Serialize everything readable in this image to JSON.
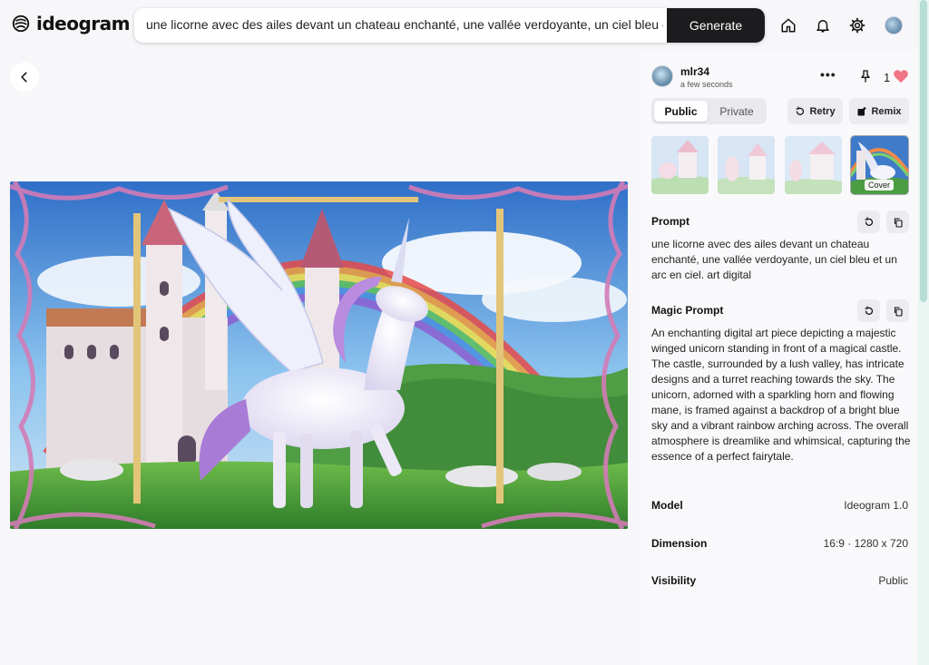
{
  "brand": {
    "name": "ideogram"
  },
  "search": {
    "value": "une licorne avec des ailes devant un chateau enchanté, une vallée verdoyante, un ciel bleu et un arc en ciel. art digital",
    "button_label": "Generate"
  },
  "header_icons": [
    "home-icon",
    "bell-icon",
    "gear-icon",
    "avatar"
  ],
  "post": {
    "username": "mlr34",
    "timestamp": "a few seconds",
    "like_count": "1",
    "visibility_options": [
      "Public",
      "Private"
    ],
    "selected_visibility": "Public",
    "retry_label": "Retry",
    "remix_label": "Remix",
    "cover_label": "Cover"
  },
  "prompt": {
    "title": "Prompt",
    "text": "une licorne avec des ailes devant un chateau enchanté, une vallée verdoyante, un ciel bleu et un arc en ciel. art digital"
  },
  "magic_prompt": {
    "title": "Magic Prompt",
    "text": "An enchanting digital art piece depicting a majestic winged unicorn standing in front of a magical castle. The castle, surrounded by a lush valley, has intricate designs and a turret reaching towards the sky. The unicorn, adorned with a sparkling horn and flowing mane, is framed against a backdrop of a bright blue sky and a vibrant rainbow arching across. The overall atmosphere is dreamlike and whimsical, capturing the essence of a perfect fairytale."
  },
  "details": [
    {
      "label": "Model",
      "value": "Ideogram 1.0"
    },
    {
      "label": "Dimension",
      "value": "16:9 · 1280 x 720"
    },
    {
      "label": "Visibility",
      "value": "Public"
    }
  ],
  "colors": {
    "accent_dark": "#1c1c1e",
    "heart": "#f07585",
    "background": "#f7f7fa"
  }
}
